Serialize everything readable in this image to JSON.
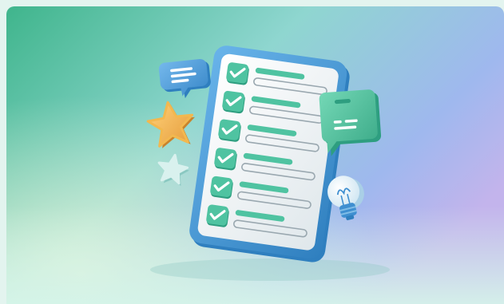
{
  "illustration": {
    "subject": "checklist",
    "colors": {
      "bg_green": "#3fb58c",
      "bg_teal": "#8fd6d0",
      "bg_blue": "#9fb8ee",
      "bg_violet": "#c3b4ec",
      "bg_mint": "#d6f5ea",
      "frame_blue": "#4a9ad6",
      "frame_dark": "#2f7fbf",
      "paper": "#edf2f4",
      "check_green": "#4fc3a1",
      "check_dark": "#2e9e80",
      "bubble_blue": "#4f9fd8",
      "bubble_green": "#56c6a2",
      "star_gold": "#f2b84f",
      "star_mint": "#d9f1ee",
      "bulb": "#e9f4fa",
      "bulb_base": "#3f8fd0"
    },
    "checklist_item_count": 6,
    "icons": [
      "clipboard-icon",
      "checkbox-icon",
      "chat-bubble-icon",
      "star-icon",
      "lightbulb-icon"
    ]
  }
}
